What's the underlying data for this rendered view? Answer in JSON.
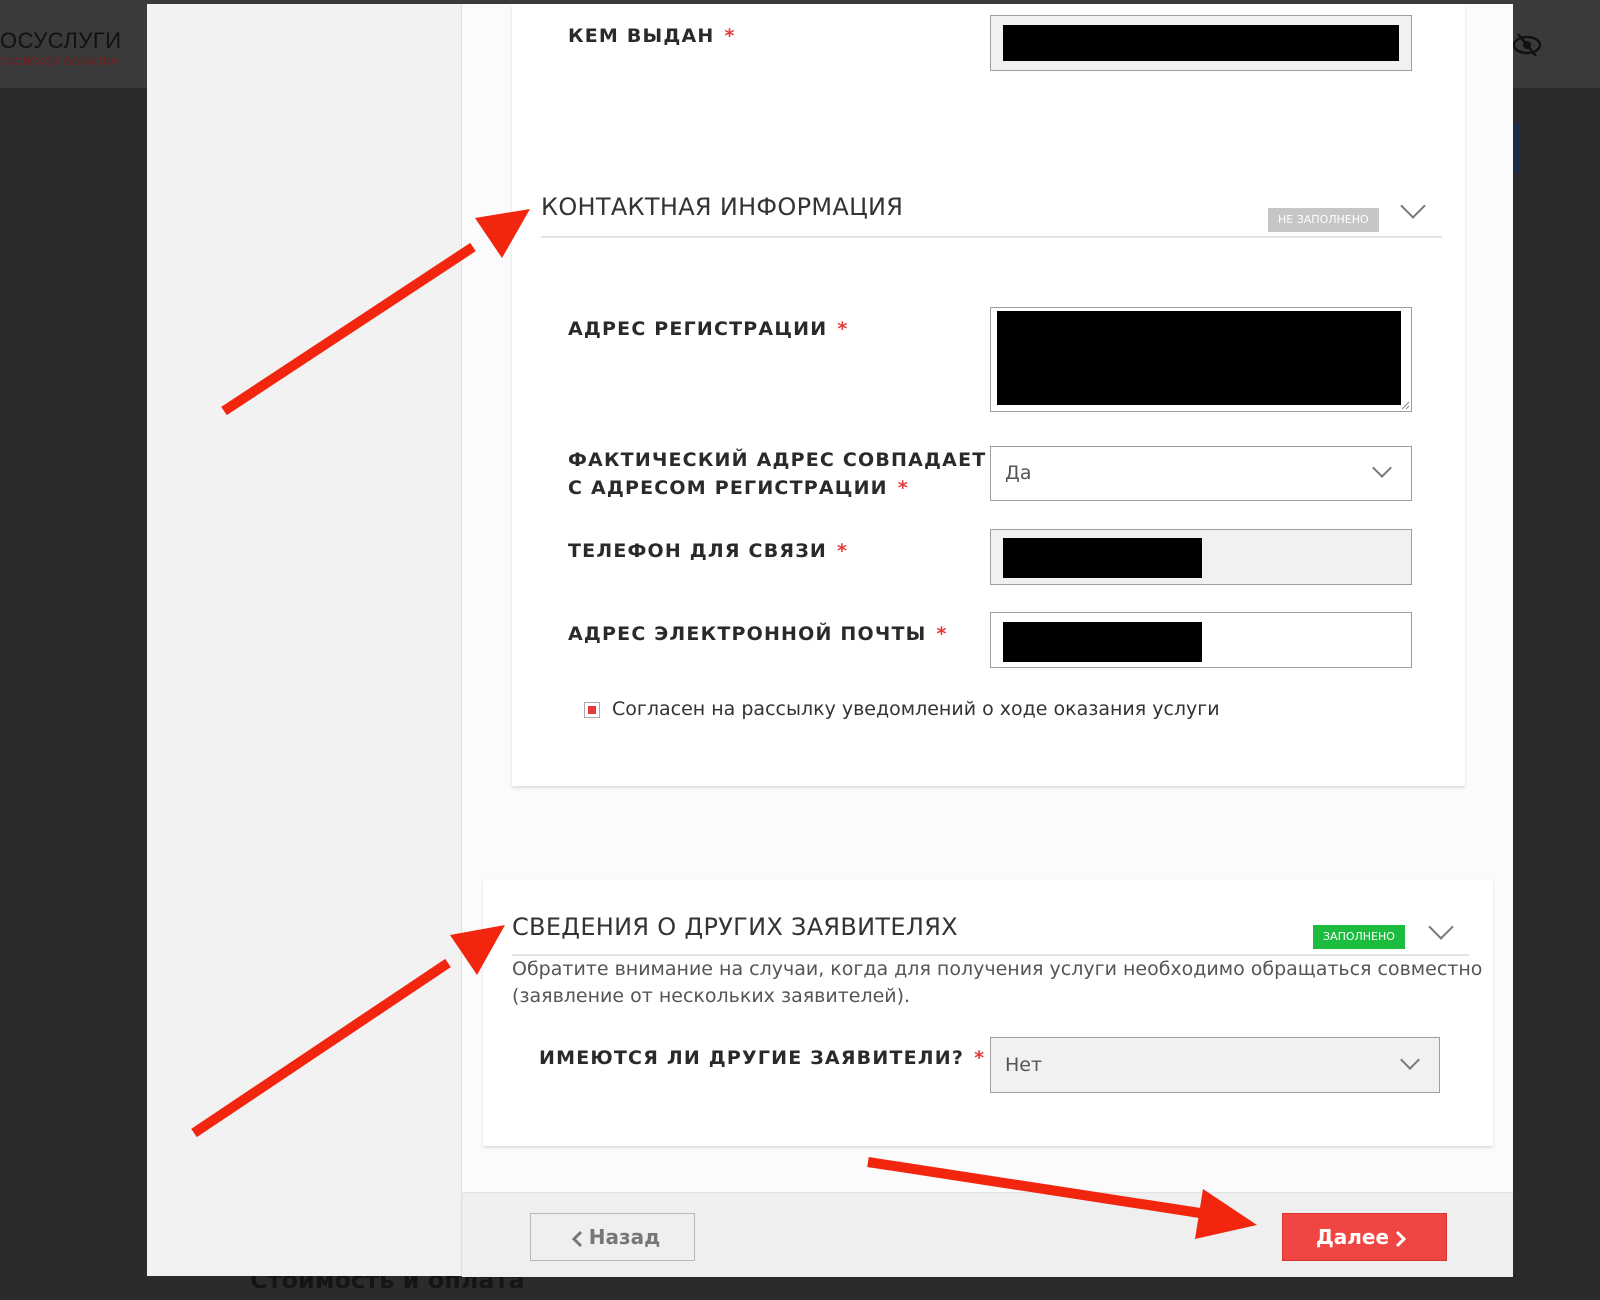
{
  "background": {
    "logo_title": "ОСУСЛУГИ",
    "logo_subtitle": "СКОВСКОЙ ОБЛАСТИ",
    "bottom_heading": "Стоимость и оплата"
  },
  "form": {
    "issued_by": {
      "label": "КЕМ ВЫДАН",
      "required_mark": "*"
    },
    "contact_section": {
      "title": "КОНТАКТНАЯ ИНФОРМАЦИЯ",
      "status": "НЕ ЗАПОЛНЕНО",
      "registration_address": {
        "label": "АДРЕС РЕГИСТРАЦИИ",
        "required_mark": "*"
      },
      "actual_address_same": {
        "label_line1": "ФАКТИЧЕСКИЙ АДРЕС СОВПАДАЕТ",
        "label_line2": "С АДРЕСОМ РЕГИСТРАЦИИ",
        "required_mark": "*",
        "value": "Да"
      },
      "phone": {
        "label": "ТЕЛЕФОН ДЛЯ СВЯЗИ",
        "required_mark": "*"
      },
      "email": {
        "label": "АДРЕС ЭЛЕКТРОННОЙ ПОЧТЫ",
        "required_mark": "*"
      },
      "consent": {
        "label": "Согласен на рассылку уведомлений о ходе оказания услуги",
        "checked": true
      }
    },
    "other_applicants_section": {
      "title": "СВЕДЕНИЯ О ДРУГИХ ЗАЯВИТЕЛЯХ",
      "status": "ЗАПОЛНЕНО",
      "note_line1": "Обратите внимание на случаи, когда для получения услуги необходимо обращаться совместно",
      "note_line2": "(заявление от нескольких заявителей).",
      "other_applicants": {
        "label": "ИМЕЮТСЯ ЛИ ДРУГИЕ ЗАЯВИТЕЛИ?",
        "required_mark": "*",
        "value": "Нет"
      }
    }
  },
  "footer": {
    "back_label": "Назад",
    "next_label": "Далее"
  },
  "colors": {
    "accent_red": "#f04542",
    "annotation_red": "#f2250f",
    "status_green": "#1cbd3f",
    "status_gray": "#c6c6c6"
  }
}
